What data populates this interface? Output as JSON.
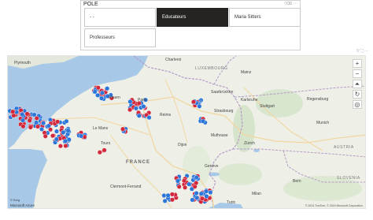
{
  "slicer": {
    "title": "POLE",
    "tiles": [
      {
        "label": "- -",
        "selected": false
      },
      {
        "label": "Educateurs",
        "selected": true
      },
      {
        "label": "Maria Sitters",
        "selected": false
      },
      {
        "label": "Professeurs",
        "selected": false
      }
    ],
    "filter_icon": "filter-icon",
    "clear_icon": "eraser-icon",
    "more_icon": "more-options-icon"
  },
  "map": {
    "labels": {
      "plymouth": "Plymouth",
      "charleroi": "Charleroi",
      "luxembourg": "LUXEMBOURG",
      "saarbrucken": "Saarbrücken",
      "mainz": "Mainz",
      "karlsruhe": "Karlsruhe",
      "stuttgart": "Stuttgart",
      "regensburg": "Regensburg",
      "strasbourg": "Strasbourg",
      "munich": "Munich",
      "reims": "Reims",
      "rouen": "Rouen",
      "le_mans": "Le Mans",
      "tours": "Tours",
      "dijon": "Dijon",
      "mulhouse": "Mulhouse",
      "france": "FRANCE",
      "austria": "AUSTRIA",
      "slovenia": "SLOVENIA",
      "clermont": "Clermont-Ferrand",
      "lyon": "Lyon",
      "milan": "Milan",
      "bern": "Bern",
      "zurich": "Zürich",
      "bordeaux": "Bordeaux",
      "switzerland": "SWITZ.",
      "geneva": "Genève",
      "turin": "Turin",
      "paris": "Paris"
    },
    "controls": [
      "plus-icon",
      "minus-icon",
      "tilt-icon",
      "rotate-icon",
      "locate-icon"
    ],
    "attribution": "© 2024 TomTom, © 2024 Microsoft Corporation",
    "brand": "Microsoft Azure",
    "bing": "© Bing",
    "colors": {
      "land": "#eef0e8",
      "sea": "#a7c8e6",
      "red_series": "#d2283b",
      "blue_series": "#2b76d8",
      "border": "#b59bc5",
      "road": "#f2d6a1",
      "forest": "#cfe0c3"
    }
  }
}
